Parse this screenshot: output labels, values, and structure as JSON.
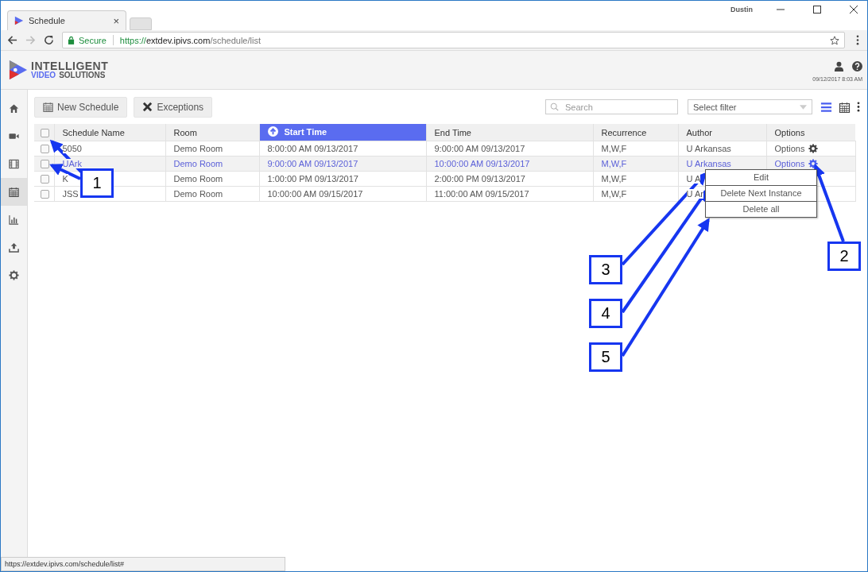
{
  "browser": {
    "tab_title": "Schedule",
    "tab_close": "×",
    "profile": "Dustin",
    "secure_label": "Secure",
    "url_scheme": "https://",
    "url_host": "extdev.ipivs.com",
    "url_path": "/schedule/list",
    "status_url": "https://extdev.ipivs.com/schedule/list#"
  },
  "header": {
    "logo_top": "INTELLIGENT",
    "logo_left": "VIDEO",
    "logo_right": "SOLUTIONS",
    "datetime": "09/12/2017 8:03 AM"
  },
  "sidebar": {
    "items": [
      {
        "kind": "home",
        "selected": false
      },
      {
        "kind": "camera",
        "selected": false
      },
      {
        "kind": "film",
        "selected": false
      },
      {
        "kind": "calendar",
        "selected": true
      },
      {
        "kind": "chart",
        "selected": false
      },
      {
        "kind": "upload",
        "selected": false
      },
      {
        "kind": "gear",
        "selected": false
      }
    ]
  },
  "toolbar": {
    "buttons": [
      {
        "kind": "calendar",
        "label": "New Schedule"
      },
      {
        "kind": "cross",
        "label": "Exceptions"
      }
    ],
    "search": {
      "placeholder": "Search"
    },
    "filter": {
      "placeholder": "Select filter"
    },
    "views": [
      {
        "kind": "list",
        "selected": true
      },
      {
        "kind": "calendar",
        "selected": false
      }
    ]
  },
  "table": {
    "select_all": {
      "checked": false
    },
    "columns": [
      {
        "label": "Schedule Name",
        "sorted": false
      },
      {
        "label": "Room",
        "sorted": false
      },
      {
        "label": "Start Time",
        "sorted": true
      },
      {
        "label": "End Time",
        "sorted": false
      },
      {
        "label": "Recurrence",
        "sorted": false
      },
      {
        "label": "Author",
        "sorted": false
      },
      {
        "label": "Options",
        "sorted": false
      }
    ],
    "rows": [
      {
        "checked": false,
        "selected": false,
        "cells": [
          "5050",
          "Demo Room",
          "8:00:00 AM 09/13/2017",
          "9:00:00 AM 09/13/2017",
          "M,W,F",
          "U Arkansas"
        ],
        "options": "Options"
      },
      {
        "checked": false,
        "selected": true,
        "cells": [
          "UArk",
          "Demo Room",
          "9:00:00 AM 09/13/2017",
          "10:00:00 AM 09/13/2017",
          "M,W,F",
          "U Arkansas"
        ],
        "options": "Options"
      },
      {
        "checked": false,
        "selected": false,
        "cells": [
          "K",
          "Demo Room",
          "1:00:00 PM 09/13/2017",
          "2:00:00 PM 09/13/2017",
          "M,W,F",
          "U A"
        ]
      },
      {
        "checked": false,
        "selected": false,
        "cells": [
          "JSS",
          "Demo Room",
          "10:00:00 AM 09/15/2017",
          "11:00:00 AM 09/15/2017",
          "M,W,F",
          "U Ar"
        ]
      }
    ]
  },
  "options_menu": {
    "items": [
      "Edit",
      "Delete Next Instance",
      "Delete all"
    ]
  },
  "callouts": [
    {
      "label": "1"
    },
    {
      "label": "2"
    },
    {
      "label": "3"
    },
    {
      "label": "4"
    },
    {
      "label": "5"
    }
  ]
}
